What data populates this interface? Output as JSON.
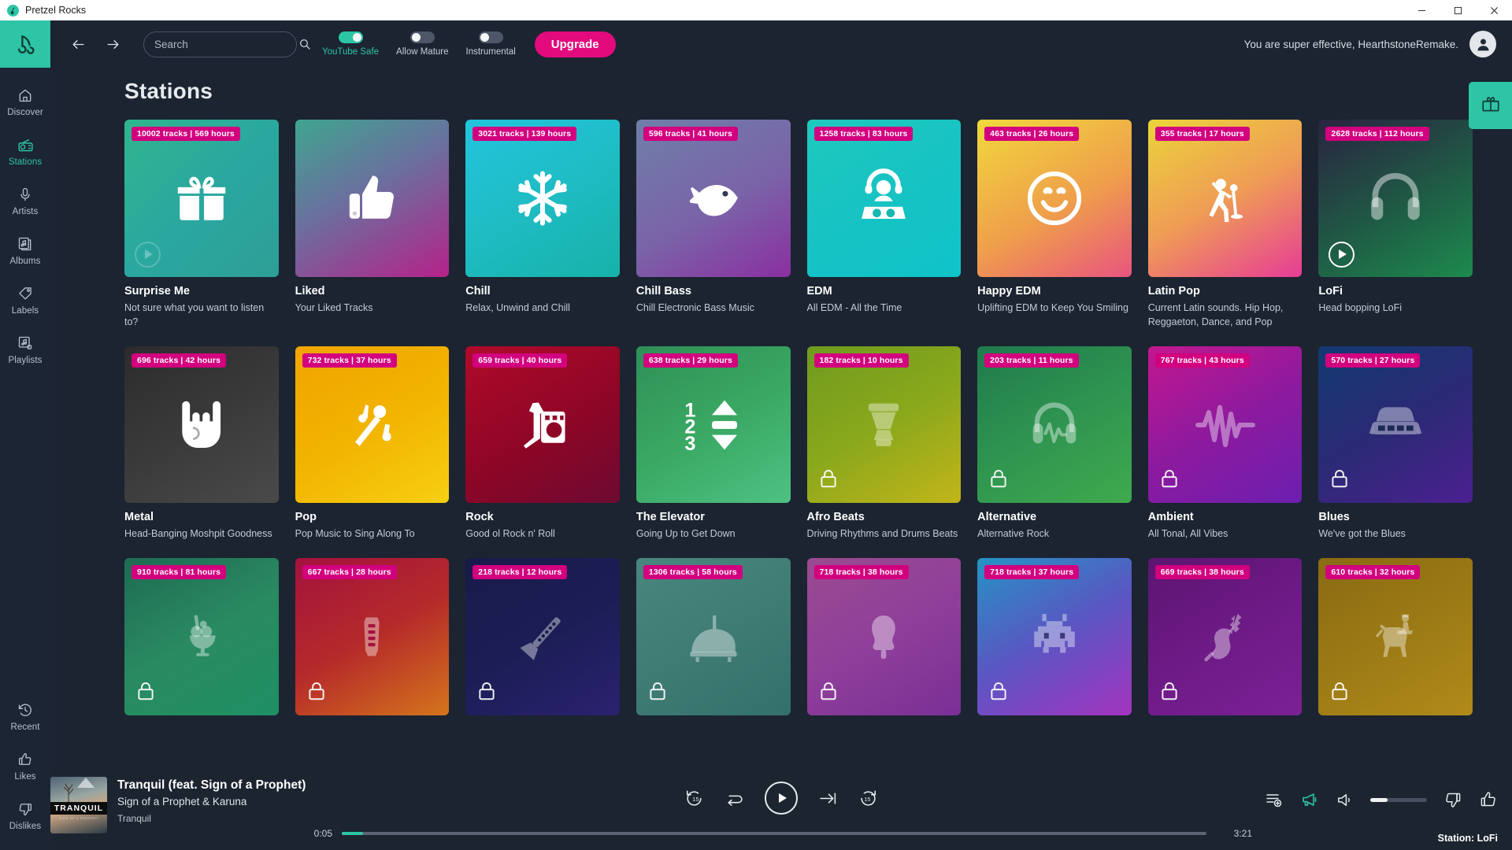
{
  "window": {
    "app_title": "Pretzel Rocks",
    "minimize": "minimize-button",
    "maximize": "maximize-button",
    "close": "close-button"
  },
  "sidebar": {
    "brand_icon": "pretzel-logo-icon",
    "top_items": [
      {
        "label": "Discover",
        "icon": "home-icon",
        "active": false
      },
      {
        "label": "Stations",
        "icon": "radio-icon",
        "active": true
      },
      {
        "label": "Artists",
        "icon": "microphone-icon",
        "active": false
      },
      {
        "label": "Albums",
        "icon": "album-icon",
        "active": false
      },
      {
        "label": "Labels",
        "icon": "tag-icon",
        "active": false
      },
      {
        "label": "Playlists",
        "icon": "playlist-icon",
        "active": false
      }
    ],
    "bottom_items": [
      {
        "label": "Recent",
        "icon": "history-icon",
        "active": false
      },
      {
        "label": "Likes",
        "icon": "thumbs-up-icon",
        "active": false
      },
      {
        "label": "Dislikes",
        "icon": "thumbs-down-icon",
        "active": false
      }
    ]
  },
  "topbar": {
    "back_icon": "arrow-left-icon",
    "forward_icon": "arrow-right-icon",
    "search": {
      "value": "",
      "placeholder": "Search",
      "icon": "search-icon"
    },
    "toggles": [
      {
        "label": "YouTube Safe",
        "on": true
      },
      {
        "label": "Allow Mature",
        "on": false
      },
      {
        "label": "Instrumental",
        "on": false
      }
    ],
    "upgrade_label": "Upgrade",
    "greeting": "You are super effective, HearthstoneRemake.",
    "avatar_icon": "user-avatar-icon"
  },
  "page": {
    "title": "Stations",
    "gift_tab_icon": "gift-icon"
  },
  "stations": [
    {
      "title": "Surprise Me",
      "subtitle": "Not sure what you want to listen to?",
      "badge": "10002 tracks | 569 hours",
      "icon": "gift-icon",
      "gradient": "linear-gradient(135deg,#2fb58c 0%,#2aa8a0 50%,#2e9e96 100%)",
      "locked": false,
      "playing": false,
      "hovered": true
    },
    {
      "title": "Liked",
      "subtitle": "Your Liked Tracks",
      "badge": "",
      "icon": "thumbs-up-icon",
      "gradient": "linear-gradient(150deg,#3fa58e 0%,#6b6f9e 45%,#b5228a 100%)",
      "locked": false,
      "playing": false,
      "hovered": false
    },
    {
      "title": "Chill",
      "subtitle": "Relax, Unwind and Chill",
      "badge": "3021 tracks | 139 hours",
      "icon": "snowflake-icon",
      "gradient": "linear-gradient(150deg,#22c5dd 0%,#1fbcc4 50%,#16b2a8 100%)",
      "locked": false,
      "playing": false,
      "hovered": false
    },
    {
      "title": "Chill Bass",
      "subtitle": "Chill Electronic Bass Music",
      "badge": "596 tracks | 41 hours",
      "icon": "fish-icon",
      "gradient": "linear-gradient(150deg,#6f7fa8 0%,#7a63a8 55%,#8b2fa0 100%)",
      "locked": false,
      "playing": false,
      "hovered": false
    },
    {
      "title": "EDM",
      "subtitle": "All EDM - All the Time",
      "badge": "1258 tracks | 83 hours",
      "icon": "dj-icon",
      "gradient": "linear-gradient(150deg,#1fc9bd 0%,#17c3c3 50%,#0fc3c9 100%)",
      "locked": false,
      "playing": false,
      "hovered": false
    },
    {
      "title": "Happy EDM",
      "subtitle": "Uplifting EDM to Keep You Smiling",
      "badge": "463 tracks | 26 hours",
      "icon": "smiley-icon",
      "gradient": "linear-gradient(150deg,#f0d93c 0%,#ef9f4b 55%,#e8547f 100%)",
      "locked": false,
      "playing": false,
      "hovered": false
    },
    {
      "title": "Latin Pop",
      "subtitle": "Current Latin sounds. Hip Hop, Reggaeton, Dance, and Pop",
      "badge": "355 tracks | 17 hours",
      "icon": "singer-icon",
      "gradient": "linear-gradient(150deg,#ebd43a 0%,#ef9d55 50%,#e63c96 100%)",
      "locked": false,
      "playing": false,
      "hovered": false
    },
    {
      "title": "LoFi",
      "subtitle": "Head bopping LoFi",
      "badge": "2628 tracks | 112 hours",
      "icon": "headphones-icon",
      "gradient": "linear-gradient(150deg,#2a2340 0%,#1f5b45 55%,#1d8a4e 100%)",
      "locked": false,
      "playing": true,
      "hovered": false
    },
    {
      "title": "Metal",
      "subtitle": "Head-Banging Moshpit Goodness",
      "badge": "696 tracks | 42 hours",
      "icon": "rock-hand-icon",
      "gradient": "linear-gradient(150deg,#2c2c2c 0%,#3a3a3a 50%,#4a4a4a 100%)",
      "locked": false,
      "playing": false,
      "hovered": false
    },
    {
      "title": "Pop",
      "subtitle": "Pop Music to Sing Along To",
      "badge": "732 tracks | 37 hours",
      "icon": "karaoke-icon",
      "gradient": "linear-gradient(150deg,#f0a400 0%,#f2b300 50%,#f6cf12 100%)",
      "locked": false,
      "playing": false,
      "hovered": false
    },
    {
      "title": "Rock",
      "subtitle": "Good ol Rock n' Roll",
      "badge": "659 tracks | 40 hours",
      "icon": "guitar-amp-icon",
      "gradient": "linear-gradient(150deg,#b00a2a 0%,#8e0626 55%,#6d0a32 100%)",
      "locked": false,
      "playing": false,
      "hovered": false
    },
    {
      "title": "The Elevator",
      "subtitle": "Going Up to Get Down",
      "badge": "638 tracks | 29 hours",
      "icon": "elevator-icon",
      "gradient": "linear-gradient(150deg,#2f8f57 0%,#3aa863 50%,#4ec183 100%)",
      "locked": false,
      "playing": false,
      "hovered": false
    },
    {
      "title": "Afro Beats",
      "subtitle": "Driving Rhythms and Drums Beats",
      "badge": "182 tracks | 10 hours",
      "icon": "djembe-icon",
      "gradient": "linear-gradient(150deg,#6f9a1e 0%,#8aa81c 50%,#c2b51a 100%)",
      "locked": true,
      "playing": false,
      "hovered": false
    },
    {
      "title": "Alternative",
      "subtitle": "Alternative Rock",
      "badge": "203 tracks | 11 hours",
      "icon": "headphone-pulse-icon",
      "gradient": "linear-gradient(150deg,#1f7a4d 0%,#2f9450 50%,#3faa4e 100%)",
      "locked": true,
      "playing": false,
      "hovered": false
    },
    {
      "title": "Ambient",
      "subtitle": "All Tonal, All Vibes",
      "badge": "767 tracks | 43 hours",
      "icon": "waveform-icon",
      "gradient": "linear-gradient(150deg,#c3178f 0%,#8d1a9e 50%,#6b1fb0 100%)",
      "locked": true,
      "playing": false,
      "hovered": false
    },
    {
      "title": "Blues",
      "subtitle": "We've got the Blues",
      "badge": "570 tracks | 27 hours",
      "icon": "harmonica-icon",
      "gradient": "linear-gradient(150deg,#123a72 0%,#2b2a74 50%,#4b2090 100%)",
      "locked": true,
      "playing": false,
      "hovered": false
    },
    {
      "title": "",
      "subtitle": "",
      "badge": "910 tracks | 81 hours",
      "icon": "ice-cream-icon",
      "gradient": "linear-gradient(150deg,#1e6b52 0%,#2a8a62 50%,#1f8f63 100%)",
      "locked": true,
      "playing": false,
      "hovered": false
    },
    {
      "title": "",
      "subtitle": "",
      "badge": "667 tracks | 28 hours",
      "icon": "guitar-neck-icon",
      "gradient": "linear-gradient(150deg,#a3123e 0%,#b52a2a 50%,#d4751c 100%)",
      "locked": true,
      "playing": false,
      "hovered": false
    },
    {
      "title": "",
      "subtitle": "",
      "badge": "218 tracks | 12 hours",
      "icon": "clarinet-icon",
      "gradient": "linear-gradient(150deg,#191a4a 0%,#1c1d55 50%,#2a2270 100%)",
      "locked": true,
      "playing": false,
      "hovered": false
    },
    {
      "title": "",
      "subtitle": "",
      "badge": "1306 tracks | 58 hours",
      "icon": "piano-icon",
      "gradient": "linear-gradient(150deg,#49867d 0%,#3f7c74 50%,#34706a 100%)",
      "locked": true,
      "playing": false,
      "hovered": false
    },
    {
      "title": "",
      "subtitle": "",
      "badge": "718 tracks | 38 hours",
      "icon": "popsicle-icon",
      "gradient": "linear-gradient(150deg,#9a4b8f 0%,#8f3f9a 50%,#7b2f95 100%)",
      "locked": true,
      "playing": false,
      "hovered": false
    },
    {
      "title": "",
      "subtitle": "",
      "badge": "718 tracks | 37 hours",
      "icon": "space-invader-icon",
      "gradient": "linear-gradient(150deg,#2593c4 0%,#5b55c2 50%,#a434c0 100%)",
      "locked": true,
      "playing": false,
      "hovered": false
    },
    {
      "title": "",
      "subtitle": "",
      "badge": "669 tracks | 38 hours",
      "icon": "violin-icon",
      "gradient": "linear-gradient(150deg,#5d1570 0%,#6d1a86 50%,#7b2196 100%)",
      "locked": true,
      "playing": false,
      "hovered": false
    },
    {
      "title": "",
      "subtitle": "",
      "badge": "610 tracks | 32 hours",
      "icon": "horse-rider-icon",
      "gradient": "linear-gradient(150deg,#8a6a13 0%,#9c7a15 50%,#b08a1a 100%)",
      "locked": true,
      "playing": false,
      "hovered": false
    }
  ],
  "player": {
    "art_label": "TRANQUIL",
    "art_sublabel": "SIGN OF A PROPHET",
    "track_title": "Tranquil (feat. Sign of a Prophet)",
    "artist": "Sign of a Prophet & Karuna",
    "album": "Tranquil",
    "elapsed": "0:05",
    "duration": "3:21",
    "progress_percent": 2.5,
    "volume_percent": 30,
    "station_label": "Station: LoFi",
    "controls": {
      "rewind": "rewind-15-icon",
      "repeat": "repeat-icon",
      "play": "play-icon",
      "next": "skip-next-icon",
      "forward": "forward-15-icon",
      "queue": "add-to-queue-icon",
      "announce": "megaphone-icon",
      "volume": "volume-icon",
      "dislike": "thumbs-down-icon",
      "like": "thumbs-up-icon"
    }
  },
  "colors": {
    "accent_green": "#2ec4a6",
    "accent_pink": "#e20a7d",
    "badge_pink": "#d2007e",
    "bg": "#1b2430",
    "sidebar_bg": "#1c2533"
  }
}
